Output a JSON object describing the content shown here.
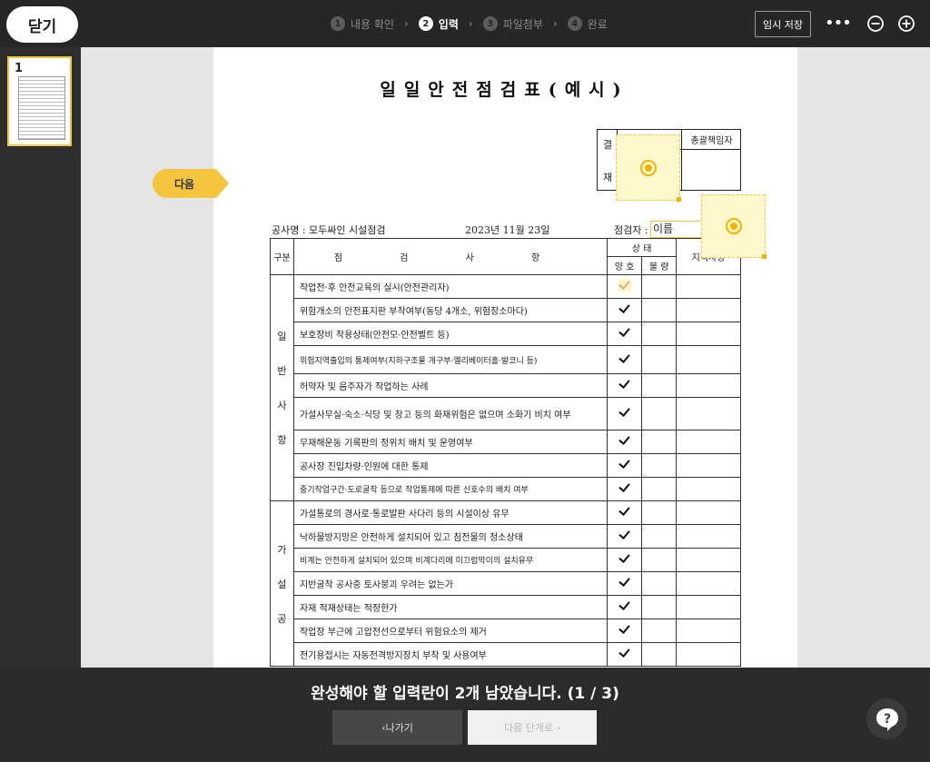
{
  "topbar": {
    "close_label": "닫기",
    "steps": [
      {
        "num": "1",
        "label": "내용 확인"
      },
      {
        "num": "2",
        "label": "입력"
      },
      {
        "num": "3",
        "label": "파일첨부"
      },
      {
        "num": "4",
        "label": "완료"
      }
    ],
    "active_step": 2,
    "save_label": "임시 저장",
    "more_icon": "more-horizontal-icon",
    "zoom_out_icon": "zoom-out-icon",
    "zoom_in_icon": "zoom-in-icon"
  },
  "sidebar": {
    "thumbnails": [
      {
        "page": "1"
      }
    ]
  },
  "canvas": {
    "next_tag": "다음"
  },
  "document": {
    "title": "일일안전점검표(예시)",
    "approval": {
      "left_top": "결",
      "left_bottom": "재",
      "head2": "총괄책임자"
    },
    "project": "공사명 : 모두싸인 시설점검",
    "date": "2023년 11월 23일",
    "inspector_label": "점검자 :",
    "inspector_name": "이름",
    "table": {
      "h_section": "구분",
      "h_items": "점 검 사 항",
      "h_status": "상 태",
      "h_good": "양 호",
      "h_bad": "불 량",
      "h_note": "지적사항",
      "sections": [
        {
          "label": "일반사항",
          "letters": [
            "일",
            "반",
            "사",
            "항"
          ],
          "rows": [
            {
              "item": "작업전·후 안전교육의 실시(안전관리자)",
              "good": "pending"
            },
            {
              "item": "위험개소의 안전표지판 부착여부(동당 4개소, 위험장소마다)",
              "good": "checked"
            },
            {
              "item": "보호장비 착용상태(안전모·안전벨트 등)",
              "good": "checked"
            },
            {
              "item": "위험지역출입의 통제여부(지하구조물 개구부·엘리베이터홀·발코니 등)",
              "good": "checked"
            },
            {
              "item": "허약자 및 음주자가 작업하는 사례",
              "good": "checked"
            },
            {
              "item": "가설사무실·숙소·식당 및 창고 등의 화재위험은 없으며 소화기 비치 여부",
              "good": "checked"
            },
            {
              "item": "무재해운동 기록판의 정위치 배치 및 운영여부",
              "good": "checked"
            },
            {
              "item": "공사장 진입차량·인원에 대한 통제",
              "good": "checked"
            },
            {
              "item": "중기작업구간·도로굴착 등으로 작업통제에 따른 신호수의 배치 여부",
              "good": "checked"
            }
          ]
        },
        {
          "label": "가설공",
          "letters": [
            "가",
            "설",
            "공"
          ],
          "rows": [
            {
              "item": "가설통로의 경사로·통로발판 사다리 등의 시설이상 유무",
              "good": "checked"
            },
            {
              "item": "낙하물방지망은 안전하게 설치되어 있고 침전물의 청소상태",
              "good": "checked"
            },
            {
              "item": "비계는 안전하게 설치되어 있으며 비계다리에 미끄럼막이의 설치유무",
              "good": "checked"
            },
            {
              "item": "지반굴착 공사중 토사붕괴 우려는 없는가",
              "good": "checked"
            },
            {
              "item": "자재 적재상태는 적정한가",
              "good": "checked"
            },
            {
              "item": "작업장 부근에 고압전선으로부터 위험요소의 제거",
              "good": "checked"
            },
            {
              "item": "전기용접시는 자동전격방지장치 부착 및 사용여부",
              "good": "checked"
            }
          ]
        }
      ]
    }
  },
  "bottombar": {
    "message": "완성해야 할 입력란이 2개 남았습니다. (1 / 3)",
    "prev_label": "‹나가기",
    "next_label": "다음 단계로 ›",
    "help_icon": "help-icon"
  },
  "colors": {
    "accent": "#f5c542",
    "topbar_bg": "#262626",
    "canvas_bg": "#e5e5e5",
    "bottombar_bg": "#2b2b2b"
  }
}
